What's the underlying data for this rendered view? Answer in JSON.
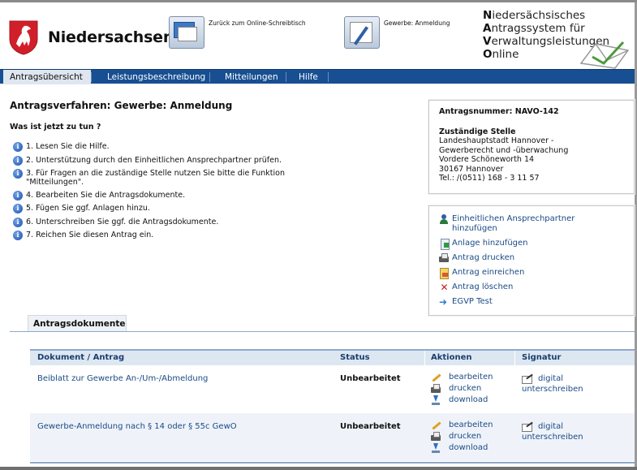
{
  "header": {
    "brand": "Niedersachsen",
    "link_desktop": "Zurück zum Online-Schreibtisch",
    "link_registration": "Gewerbe: Anmeldung",
    "system_title_lines": [
      "Niedersächsisches",
      "Antragssystem für",
      "Verwaltungsleistungen",
      "Online"
    ],
    "system_title_initials": [
      "N",
      "A",
      "V",
      "O"
    ]
  },
  "nav": {
    "items": [
      {
        "label": "Antragsübersicht",
        "active": true
      },
      {
        "label": "Leistungsbeschreibung",
        "active": false
      },
      {
        "label": "Mitteilungen",
        "active": false
      },
      {
        "label": "Hilfe",
        "active": false
      }
    ]
  },
  "main": {
    "title": "Antragsverfahren: Gewerbe: Anmeldung",
    "subheading": "Was ist jetzt zu tun ?",
    "steps": [
      "1. Lesen Sie die Hilfe.",
      "2. Unterstützung durch den Einheitlichen Ansprechpartner prüfen.",
      "3. Für Fragen an die zuständige Stelle nutzen Sie bitte die Funktion \"Mitteilungen\".",
      "4. Bearbeiten Sie die Antragsdokumente.",
      "5. Fügen Sie ggf. Anlagen hinzu.",
      "6. Unterschreiben Sie ggf. die Antragsdokumente.",
      "7. Reichen Sie diesen Antrag ein."
    ]
  },
  "info_box": {
    "application_number": "Antragsnummer: NAVO-142",
    "authority_label": "Zuständige Stelle",
    "authority_lines": [
      "Landeshauptstadt Hannover -",
      "Gewerberecht und -überwachung",
      "Vordere Schöneworth 14",
      "30167 Hannover",
      "Tel.: /(0511) 168 - 3 11 57"
    ]
  },
  "actions_box": {
    "add_contact": "Einheitlichen Ansprechpartner hinzufügen",
    "add_attachment": "Anlage hinzufügen",
    "print": "Antrag drucken",
    "submit": "Antrag einreichen",
    "delete": "Antrag löschen",
    "test": "EGVP Test"
  },
  "documents": {
    "section_title": "Antragsdokumente",
    "columns": [
      "Dokument / Antrag",
      "Status",
      "Aktionen",
      "Signatur"
    ],
    "rows": [
      {
        "document": "Beiblatt zur Gewerbe An-/Um-/Abmeldung",
        "status": "Unbearbeitet",
        "actions": [
          "bearbeiten",
          "drucken",
          "download"
        ],
        "signature": [
          "digital",
          "unterschreiben"
        ]
      },
      {
        "document": "Gewerbe-Anmeldung nach § 14 oder § 55c GewO",
        "status": "Unbearbeitet",
        "actions": [
          "bearbeiten",
          "drucken",
          "download"
        ],
        "signature": [
          "digital",
          "unterschreiben"
        ]
      }
    ]
  },
  "icons": {
    "logo": "lower-saxony-horse-crest",
    "step": "info-icon",
    "add_contact": "person-icon",
    "add_attachment": "attachment-icon",
    "print": "printer-icon",
    "submit": "submit-icon",
    "delete": "delete-x-icon",
    "test": "arrow-right-icon",
    "edit": "pencil-icon",
    "download": "download-icon",
    "sign": "signature-icon"
  },
  "colors": {
    "nav_bg": "#174f92",
    "link": "#1a4a86",
    "table_header_bg": "#dde7f2",
    "alt_row_bg": "#eff3f9",
    "crest_red": "#d11f2a"
  }
}
